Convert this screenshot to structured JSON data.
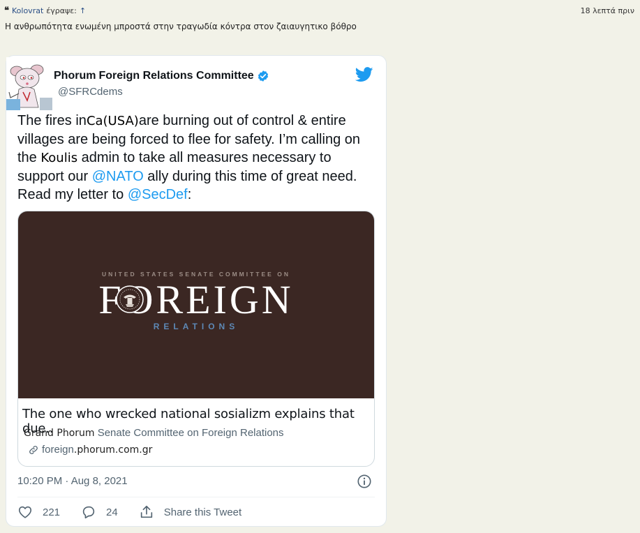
{
  "quote": {
    "mark": "❝",
    "author": "Kolovrat",
    "wrote": "έγραψε:",
    "arrow": "↑",
    "time": "18 λεπτά πριν",
    "text": "Η ανθρωπότητα ενωμένη μπροστά στην τραγωδία κόντρα στον ζαιαυγητικο βόθρο"
  },
  "tweet": {
    "name_prefix": "Phorum",
    "name": "Foreign Relations Committee",
    "handle": "@SFRCdems",
    "body": {
      "t1": "The fires in",
      "ins1": "Ca(USA)",
      "t2": "are burning out of control & entire villages are being forced to flee for safety. I’m calling on the ",
      "ins2": "Koulis",
      "t3": " admin to take all measures necessary to support our ",
      "mention1": "@NATO",
      "t4": " ally during this time of great need. Read my letter to ",
      "mention2": "@SecDef",
      "t5": ":"
    },
    "card": {
      "pre_title": "UNITED STATES SENATE COMMITTEE ON",
      "main_title": "FOREIGN",
      "sub_title": "RELATIONS",
      "title": "The one who wrecked national sosializm explains that due..",
      "desc_lead": "Grand Phorum",
      "desc": " Senate Committee on Foreign Relations",
      "link_a": "foreign",
      "link_b": ".phorum.com.gr"
    },
    "timestamp": "10:20 PM · Aug 8, 2021",
    "likes": "221",
    "replies": "24",
    "share": "Share this Tweet",
    "colors": {
      "accent": "#1d9bf0",
      "muted": "#536471",
      "card_bg": "#3b2723"
    }
  }
}
